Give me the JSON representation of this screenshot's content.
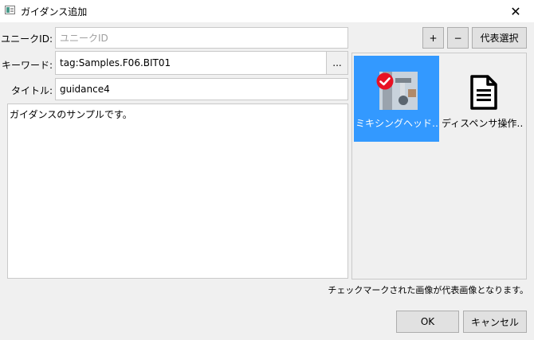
{
  "window": {
    "title": "ガイダンス追加",
    "close": "✕"
  },
  "form": {
    "uid_label": "ユニークID:",
    "uid_placeholder": "ユニークID",
    "keyword_label": "キーワード:",
    "keyword_value": "tag:Samples.F06.BIT01",
    "browse_label": "...",
    "title_label": "タイトル:",
    "title_value": "guidance4",
    "body_text": "ガイダンスのサンプルです。"
  },
  "toolbar": {
    "add_label": "+",
    "remove_label": "−",
    "representative_label": "代表選択"
  },
  "images": [
    {
      "label": "ミキシングヘッド…",
      "icon": "photo-thumbnail",
      "selected": true,
      "checked": true
    },
    {
      "label": "ディスペンサ操作…",
      "icon": "document-icon",
      "selected": false,
      "checked": false
    }
  ],
  "hint": "チェックマークされた画像が代表画像となります。",
  "buttons": {
    "ok_label": "OK",
    "cancel_label": "キャンセル"
  },
  "colors": {
    "selection": "#3399ff",
    "check": "#e81123"
  }
}
